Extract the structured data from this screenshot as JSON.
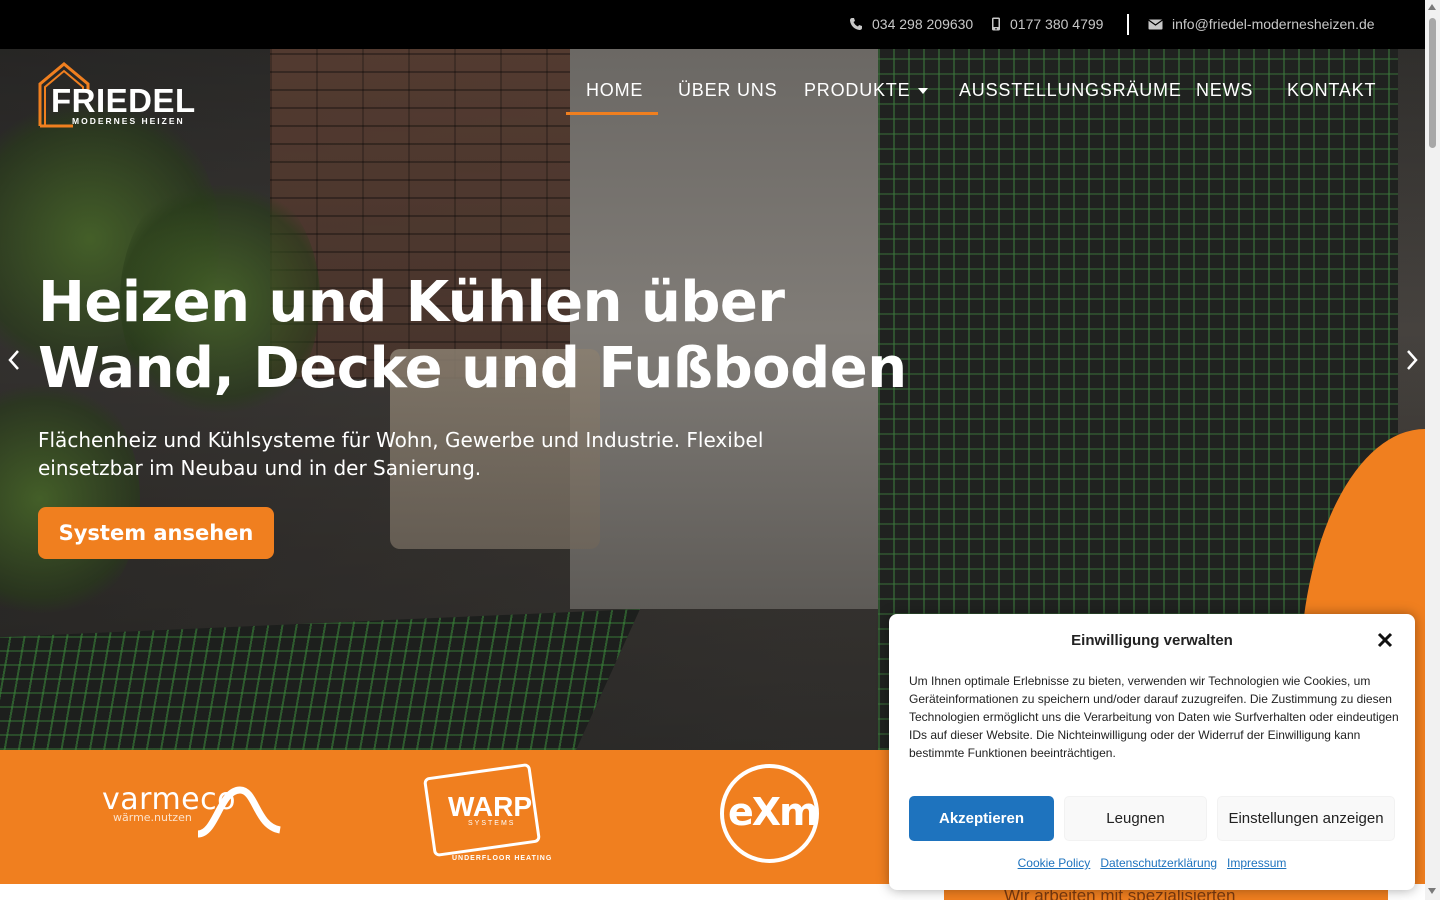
{
  "topbar": {
    "phone": "034 298 209630",
    "mobile": "0177 380 4799",
    "email": "info@friedel-modernesheizen.de"
  },
  "logo": {
    "name": "FRIEDEL",
    "tagline": "MODERNES HEIZEN"
  },
  "nav": {
    "items": [
      {
        "label": "HOME",
        "active": true
      },
      {
        "label": "ÜBER UNS"
      },
      {
        "label": "PRODUKTE",
        "has_dropdown": true
      },
      {
        "label": "AUSSTELLUNGSRÄUME"
      },
      {
        "label": "NEWS"
      },
      {
        "label": "KONTAKT"
      }
    ]
  },
  "hero": {
    "title_line1": "Heizen und Kühlen über",
    "title_line2": "Wand, Decke und Fußboden",
    "subtitle_line1": "Flächenheiz und Kühlsysteme für Wohn, Gewerbe und Industrie. Flexibel",
    "subtitle_line2": "einsetzbar im Neubau und in der Sanierung.",
    "cta_label": "System ansehen"
  },
  "brands": {
    "varmeco_name": "varmeco",
    "varmeco_sub": "wärme.nutzen",
    "warp_name": "WARP",
    "warp_systems": "SYSTEMS",
    "warp_foot": "UNDERFLOOR HEATING",
    "exm_name": "eXm"
  },
  "below_text": "Wir arbeiten mit spezialisierten",
  "cookie": {
    "title": "Einwilligung verwalten",
    "text": "Um Ihnen optimale Erlebnisse zu bieten, verwenden wir Technologien wie Cookies, um Geräteinformationen zu speichern und/oder darauf zuzugreifen. Die Zustimmung zu diesen Technologien ermöglicht uns die Verarbeitung von Daten wie Surfverhalten oder eindeutigen IDs auf dieser Website. Die Nichteinwilligung oder der Widerruf der Einwilligung kann bestimmte Funktionen beeinträchtigen.",
    "accept": "Akzeptieren",
    "deny": "Leugnen",
    "preferences": "Einstellungen anzeigen",
    "links": [
      "Cookie Policy",
      "Datenschutzerklärung",
      "Impressum"
    ]
  },
  "colors": {
    "accent": "#f07f1f",
    "accept_button": "#1e73be",
    "topbar": "#000000"
  },
  "icons": [
    "phone-icon",
    "mobile-icon",
    "envelope-icon",
    "caret-down-icon",
    "chevron-left-icon",
    "chevron-right-icon",
    "close-icon"
  ]
}
